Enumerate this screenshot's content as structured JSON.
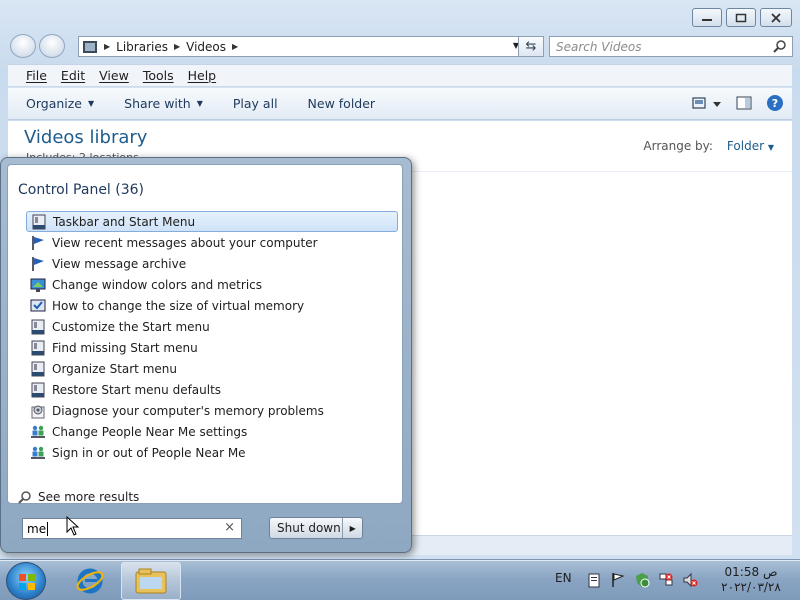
{
  "window": {
    "breadcrumb": [
      "Libraries",
      "Videos"
    ],
    "search_placeholder": "Search Videos",
    "menu": [
      "File",
      "Edit",
      "View",
      "Tools",
      "Help"
    ],
    "toolbar": {
      "organize": "Organize",
      "share_with": "Share with",
      "play_all": "Play all",
      "new_folder": "New folder"
    },
    "library_title": "Videos library",
    "library_subtitle": "Includes: 2 locations",
    "arrange_by_label": "Arrange by:",
    "arrange_by_value": "Folder"
  },
  "start_menu": {
    "group_title": "Control Panel (36)",
    "results": [
      {
        "label": "Taskbar and Start Menu",
        "icon": "taskbar-icon",
        "selected": true
      },
      {
        "label": "View recent messages about your computer",
        "icon": "action-center-flag-icon"
      },
      {
        "label": "View message archive",
        "icon": "action-center-flag-icon"
      },
      {
        "label": "Change window colors and metrics",
        "icon": "display-icon"
      },
      {
        "label": "How to change the size of virtual memory",
        "icon": "system-icon"
      },
      {
        "label": "Customize the Start menu",
        "icon": "taskbar-icon"
      },
      {
        "label": "Find missing Start menu",
        "icon": "taskbar-icon"
      },
      {
        "label": "Organize Start menu",
        "icon": "taskbar-icon"
      },
      {
        "label": "Restore Start menu defaults",
        "icon": "taskbar-icon"
      },
      {
        "label": "Diagnose your computer's memory problems",
        "icon": "admin-tools-icon"
      },
      {
        "label": "Change People Near Me settings",
        "icon": "people-near-me-icon"
      },
      {
        "label": "Sign in or out of People Near Me",
        "icon": "people-near-me-icon"
      }
    ],
    "see_more": "See more results",
    "search_value": "me",
    "shutdown_label": "Shut down"
  },
  "taskbar": {
    "language": "EN",
    "time": "01:58 ص",
    "date": "٢٠٢٢/٠٣/٢٨"
  },
  "colors": {
    "link_blue": "#1e5d8d",
    "selection_bg": "#cfe3f8",
    "taskbar": "#8aa5c3"
  }
}
